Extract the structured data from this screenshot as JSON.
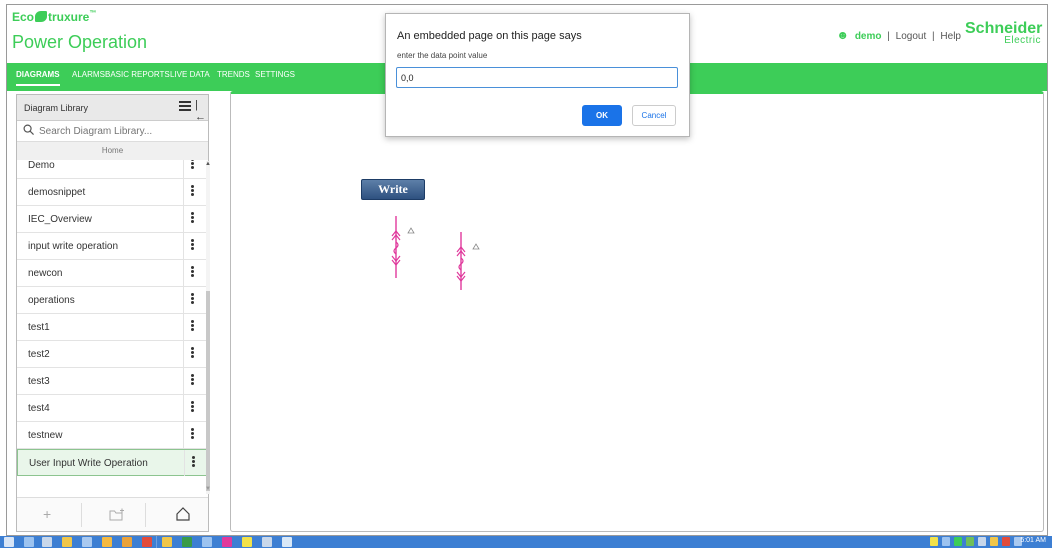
{
  "header": {
    "brand_eco": "Eco",
    "brand_struxure": "truxure",
    "brand_tm": "™",
    "product_name": "Power Operation",
    "username": "demo",
    "separator1": "|",
    "logout_label": "Logout",
    "separator2": "|",
    "help_label": "Help",
    "vendor_line1": "Schneider",
    "vendor_line2": "Electric"
  },
  "nav": {
    "items": [
      {
        "label": "DIAGRAMS",
        "active": true
      },
      {
        "label": "ALARMS"
      },
      {
        "label": "BASIC REPORTS"
      },
      {
        "label": "LIVE DATA"
      },
      {
        "label": "TRENDS"
      },
      {
        "label": "SETTINGS"
      }
    ]
  },
  "sidebar": {
    "title": "Diagram Library",
    "search_placeholder": "Search Diagram Library...",
    "home_label": "Home",
    "items": [
      {
        "label": "Demo"
      },
      {
        "label": "demosnippet"
      },
      {
        "label": "IEC_Overview"
      },
      {
        "label": "input write operation"
      },
      {
        "label": "newcon"
      },
      {
        "label": "operations"
      },
      {
        "label": "test1"
      },
      {
        "label": "test2"
      },
      {
        "label": "test3"
      },
      {
        "label": "test4"
      },
      {
        "label": "testnew"
      },
      {
        "label": "User Input Write Operation",
        "selected": true
      }
    ]
  },
  "canvas": {
    "write_button_label": "Write"
  },
  "dialog": {
    "title": "An embedded page on this page says",
    "message": "enter the data point value",
    "input_value": "0,0",
    "ok_label": "OK",
    "cancel_label": "Cancel"
  },
  "taskbar": {
    "time": "5:01 AM"
  },
  "colors": {
    "brand_green": "#3dcd58",
    "dialog_blue": "#1a73e8",
    "diagram_pink": "#e0399c",
    "taskbar_blue": "#3d7fd3"
  }
}
